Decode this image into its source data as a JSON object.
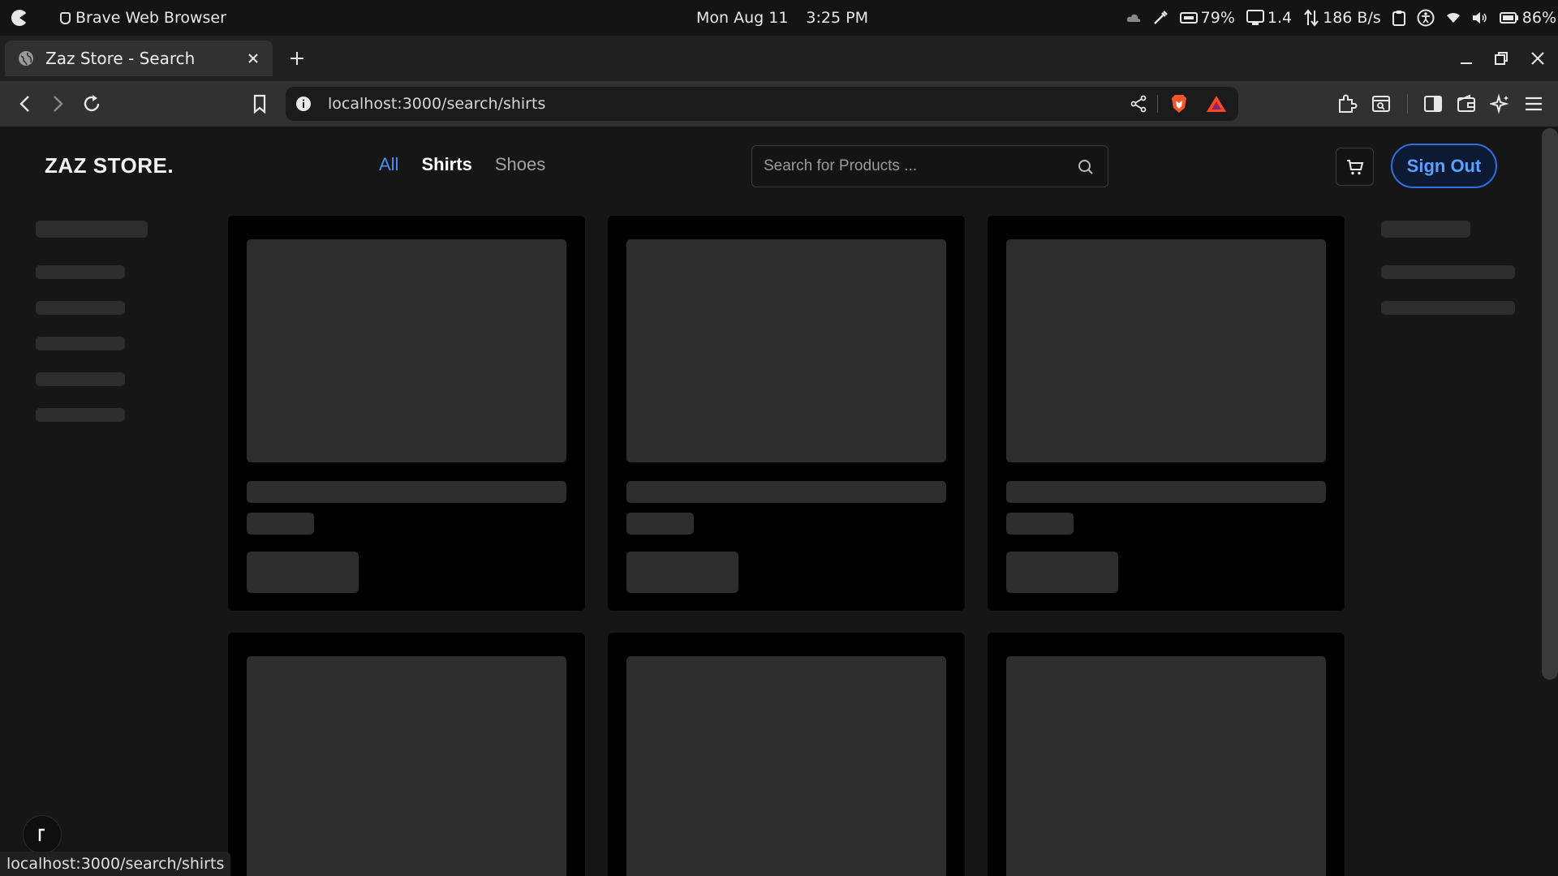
{
  "os": {
    "app_name": "Brave Web Browser",
    "date": "Mon Aug 11",
    "time": "3:25 PM",
    "cpu": "79%",
    "load": "1.4",
    "net": "186 B/s",
    "battery": "86%"
  },
  "browser": {
    "tab_title": "Zaz Store - Search",
    "url": "localhost:3000/search/shirts",
    "status_url": "localhost:3000/search/shirts"
  },
  "store": {
    "brand": "ZAZ STORE.",
    "nav": {
      "all": "All",
      "shirts": "Shirts",
      "shoes": "Shoes"
    },
    "search_placeholder": "Search for Products ...",
    "sign_out": "Sign Out"
  },
  "colors": {
    "accent": "#4b8cf5",
    "skeleton": "#2d2d2d",
    "card": "#000000"
  },
  "icons": [
    "os-logo-icon",
    "brave-icon",
    "search-icon",
    "cart-icon",
    "bookmark-icon",
    "reload-icon",
    "back-icon",
    "forward-icon",
    "share-icon",
    "extensions-icon",
    "wallet-icon",
    "leo-icon",
    "menu-icon",
    "sidebar-icon"
  ]
}
